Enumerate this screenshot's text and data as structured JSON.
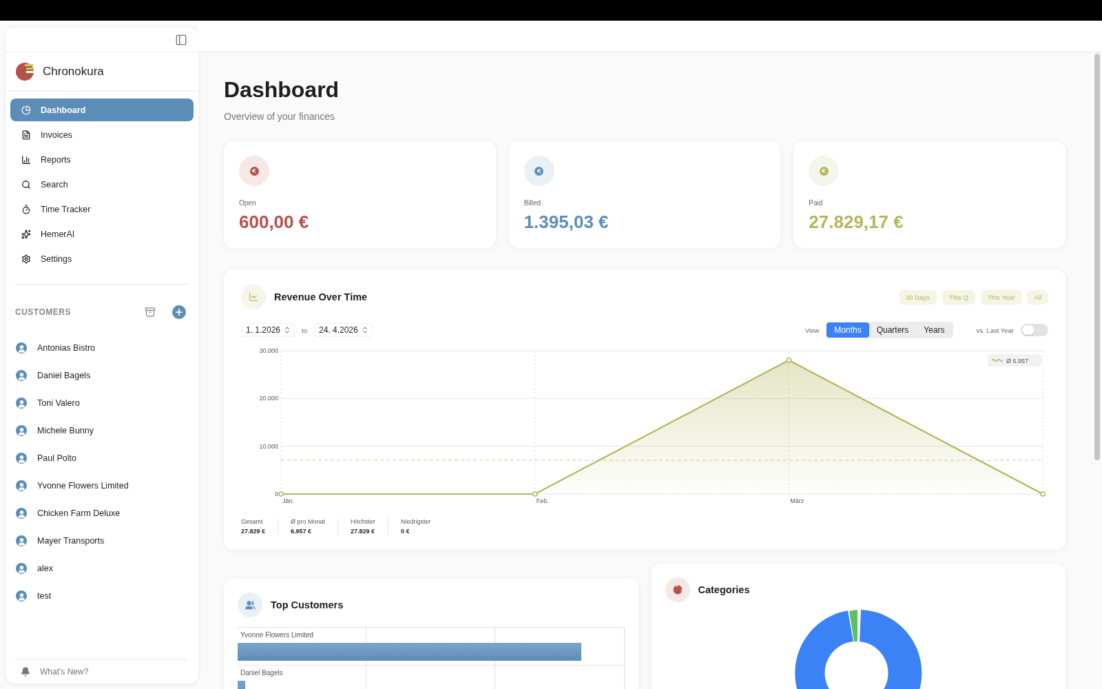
{
  "sidebar": {
    "brand": "Chronokura",
    "nav": [
      {
        "label": "Dashboard",
        "selected": true
      },
      {
        "label": "Invoices",
        "selected": false
      },
      {
        "label": "Reports",
        "selected": false
      },
      {
        "label": "Search",
        "selected": false
      },
      {
        "label": "Time Tracker",
        "selected": false
      },
      {
        "label": "HemerAI",
        "selected": false
      },
      {
        "label": "Settings",
        "selected": false
      }
    ],
    "customers_heading": "CUSTOMERS",
    "customers": [
      "Antonias Bistro",
      "Daniel Bagels",
      "Toni Valero",
      "Michele Bunny",
      "Paul Polto",
      "Yvonne Flowers Limited",
      "Chicken Farm Deluxe",
      "Mayer Transports",
      "alex",
      "test"
    ],
    "footer": "What's New?"
  },
  "page": {
    "title": "Dashboard",
    "subtitle": "Overview of your finances"
  },
  "stats": [
    {
      "label": "Open",
      "value": "600,00 €",
      "color": "#b5504a"
    },
    {
      "label": "Billed",
      "value": "1.395,03 €",
      "color": "#5b8db8"
    },
    {
      "label": "Paid",
      "value": "27.829,17 €",
      "color": "#b3b65a"
    }
  ],
  "revenue": {
    "title": "Revenue Over Time",
    "ranges": [
      {
        "label": "30 Days",
        "selected": false
      },
      {
        "label": "This Q",
        "selected": false
      },
      {
        "label": "This Year",
        "selected": false
      },
      {
        "label": "All",
        "selected": false
      }
    ],
    "from": "1. 1.2026",
    "to_label": "to",
    "to": "24. 4.2026",
    "view_label": "View",
    "views": [
      {
        "label": "Months",
        "selected": true
      },
      {
        "label": "Quarters",
        "selected": false
      },
      {
        "label": "Years",
        "selected": false
      }
    ],
    "compare": {
      "label": "vs. Last Year",
      "on": false
    },
    "chart_data": {
      "type": "area",
      "categories": [
        "Jän.",
        "Feb.",
        "März",
        null
      ],
      "ylim": [
        0,
        30000
      ],
      "yticks": [
        {
          "value": 0,
          "label": "0"
        },
        {
          "value": 10000,
          "label": "10.000"
        },
        {
          "value": 20000,
          "label": "20.000"
        },
        {
          "value": 30000,
          "label": "30.000"
        }
      ],
      "series": [
        {
          "color": "#b3b65a",
          "values": [
            0,
            0,
            28000,
            0
          ]
        }
      ]
    },
    "average_label": "Ø 6.957",
    "summary": [
      {
        "label": "Gesamt",
        "value": "27.829 €"
      },
      {
        "label": "Ø pro Monat",
        "value": "6.957 €"
      },
      {
        "label": "Höchster",
        "value": "27.829 €"
      },
      {
        "label": "Niedrigster",
        "value": "0 €"
      }
    ]
  },
  "top_customers": {
    "title": "Top Customers",
    "rows": [
      {
        "name": "Yvonne Flowers Limited",
        "level": 0.89
      },
      {
        "name": "Daniel Bagels",
        "level": 0.02
      }
    ]
  },
  "categories": {
    "title": "Categories"
  }
}
